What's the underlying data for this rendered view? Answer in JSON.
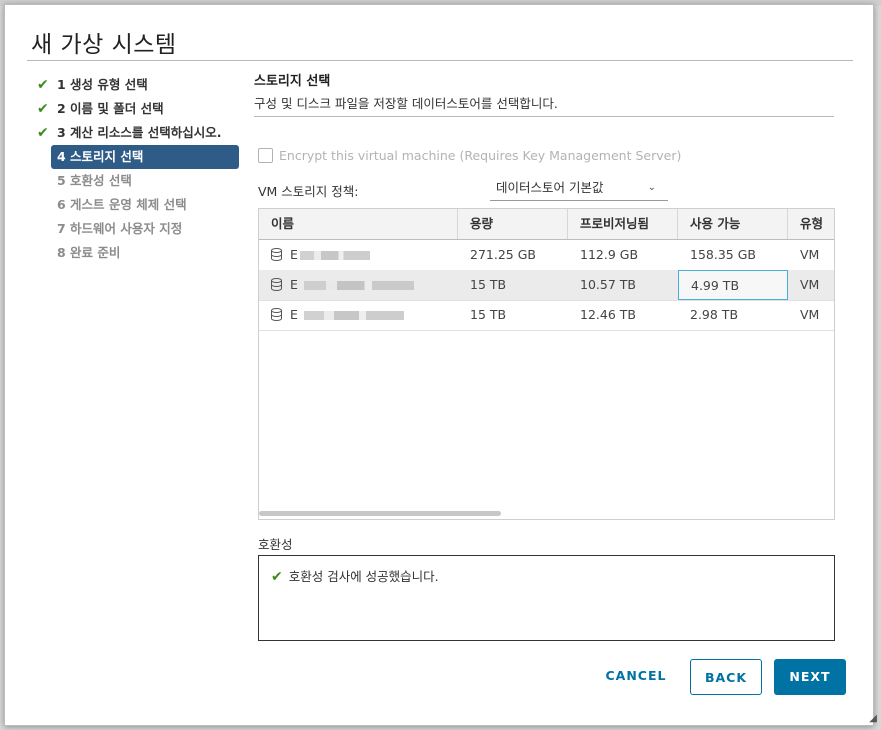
{
  "dialog": {
    "title": "새 가상 시스템"
  },
  "steps": [
    {
      "label": "1 생성 유형 선택",
      "state": "done"
    },
    {
      "label": "2 이름 및 폴더 선택",
      "state": "done"
    },
    {
      "label": "3 계산 리소스를 선택하십시오.",
      "state": "done"
    },
    {
      "label": "4 스토리지 선택",
      "state": "active"
    },
    {
      "label": "5 호환성 선택",
      "state": "future"
    },
    {
      "label": "6 게스트 운영 체제 선택",
      "state": "future"
    },
    {
      "label": "7 하드웨어 사용자 지정",
      "state": "future"
    },
    {
      "label": "8 완료 준비",
      "state": "future"
    }
  ],
  "storage": {
    "title": "스토리지 선택",
    "subtitle": "구성 및 디스크 파일을 저장할 데이터스토어를 선택합니다.",
    "encrypt_label": "Encrypt this virtual machine (Requires Key Management Server)",
    "policy_label": "VM 스토리지 정책:",
    "policy_value": "데이터스토어 기본값",
    "columns": [
      "이름",
      "용량",
      "프로비저닝됨",
      "사용 가능",
      "유형"
    ],
    "rows": [
      {
        "name": "E",
        "capacity": "271.25 GB",
        "provisioned": "112.9 GB",
        "free": "158.35 GB",
        "type": "VM"
      },
      {
        "name": "E",
        "capacity": "15 TB",
        "provisioned": "10.57 TB",
        "free": "4.99 TB",
        "type": "VM"
      },
      {
        "name": "E",
        "capacity": "15 TB",
        "provisioned": "12.46 TB",
        "free": "2.98 TB",
        "type": "VM"
      }
    ]
  },
  "compat": {
    "label": "호환성",
    "message": "호환성 검사에 성공했습니다."
  },
  "buttons": {
    "cancel": "CANCEL",
    "back": "BACK",
    "next": "NEXT"
  },
  "colors": {
    "accent": "#0072a3",
    "active_step": "#2e5c87",
    "check": "#3c8b1f"
  }
}
